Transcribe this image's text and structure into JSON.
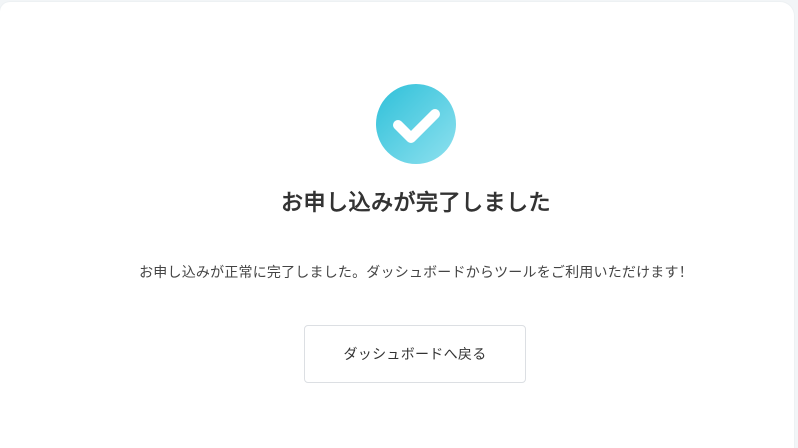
{
  "completion": {
    "icon": "check-circle-icon",
    "icon_colors": {
      "from": "#2ec0d9",
      "to": "#8fe1ef",
      "check": "#ffffff"
    },
    "title": "お申し込みが完了しました",
    "message": "お申し込みが正常に完了しました。ダッシュボードからツールをご利用いただけます！",
    "back_button_label": "ダッシュボードへ戻る"
  }
}
